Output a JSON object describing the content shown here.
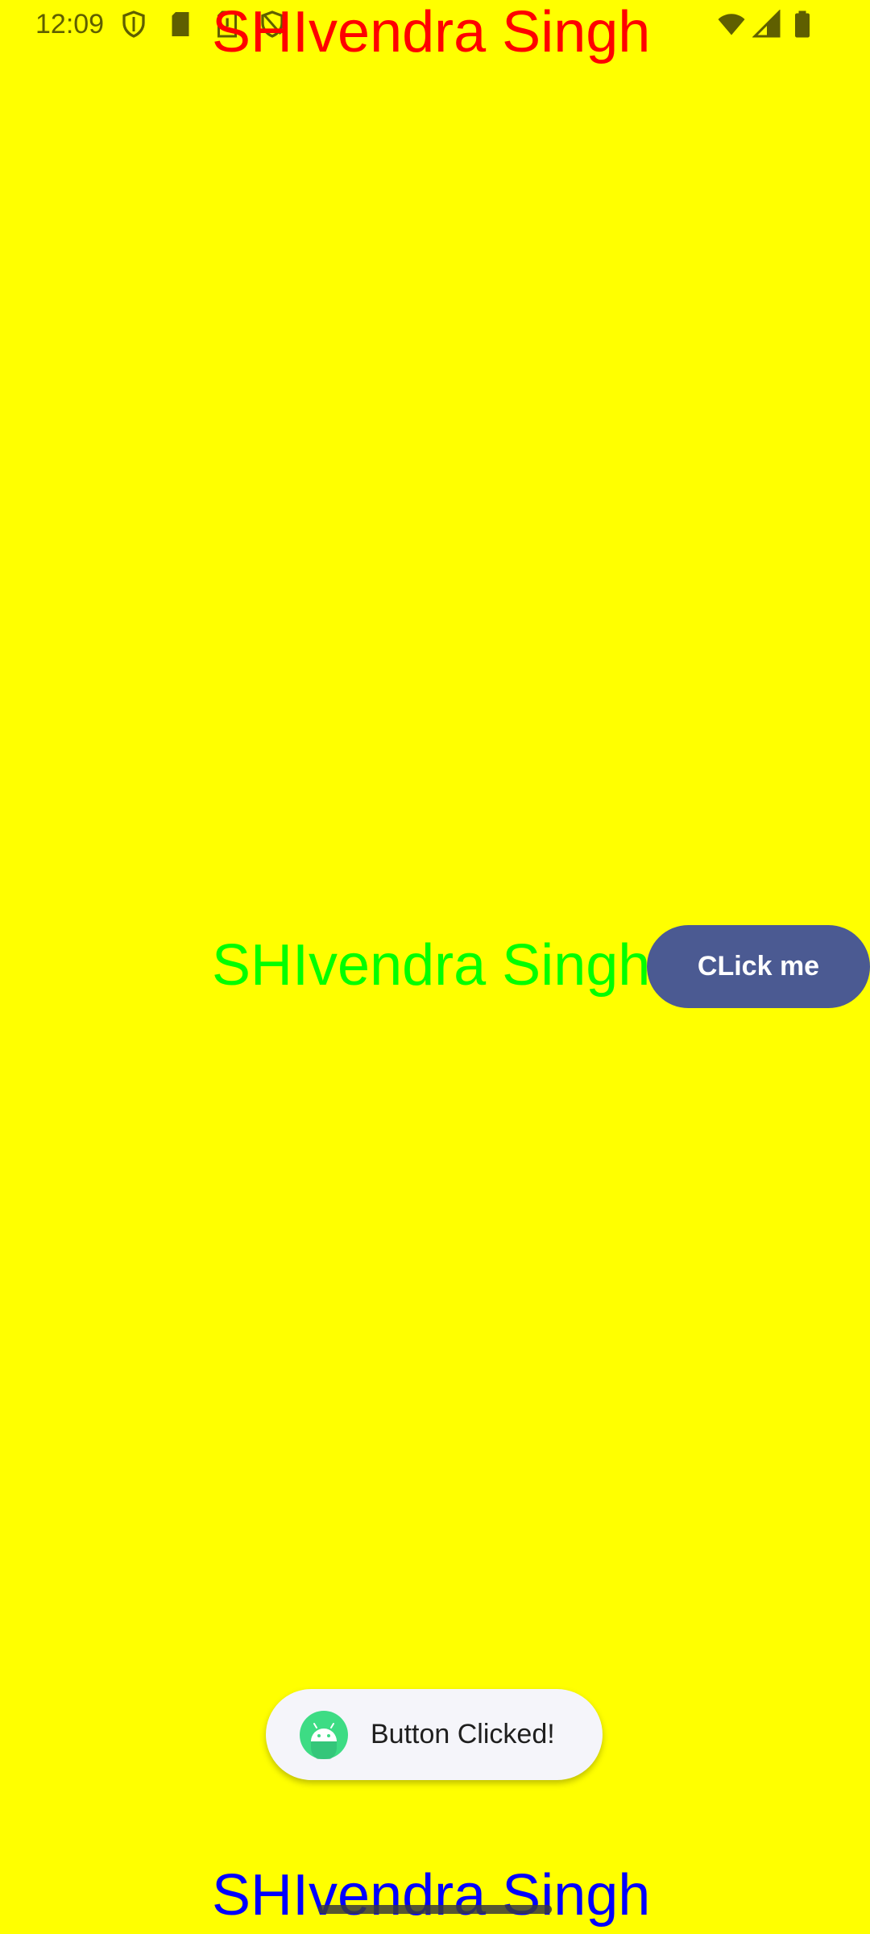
{
  "status_bar": {
    "time": "12:09",
    "icons": [
      "shield-icon",
      "sd-card-icon",
      "sim-alert-icon",
      "shield-alt-icon",
      "wifi-icon",
      "cell-signal-icon",
      "battery-icon"
    ]
  },
  "texts": {
    "top": "SHIvendra Singh",
    "middle": "SHIvendra Singh",
    "bottom": "SHIvendra Singh"
  },
  "text_colors": {
    "top": "#FF0000",
    "middle": "#00FF00",
    "bottom": "#0000FF"
  },
  "button": {
    "label": "CLick me",
    "color": "#4B5A92"
  },
  "toast": {
    "message": "Button Clicked!",
    "icon": "android-icon"
  },
  "colors": {
    "background": "#FFFF00"
  }
}
